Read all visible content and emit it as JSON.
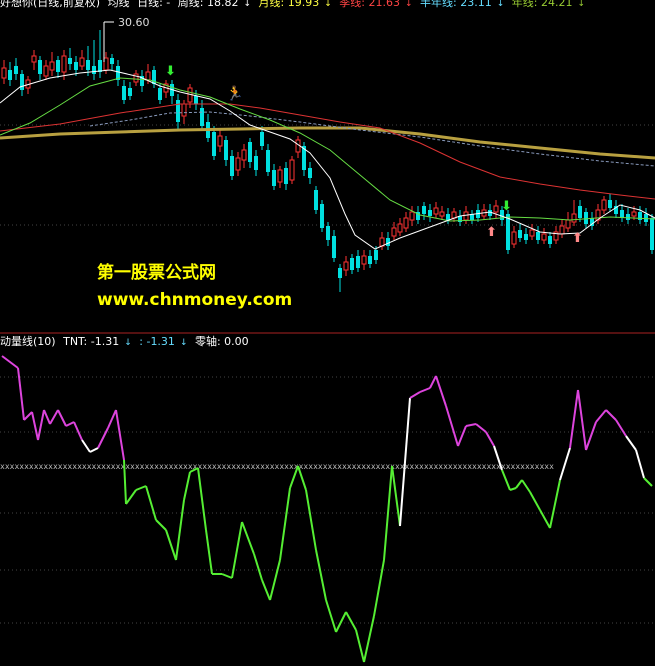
{
  "top_legend": {
    "title": "好想你(日线,前复权)",
    "indicator": "均线",
    "day_line": "日线: -",
    "week_line": "周线: 18.82",
    "month_line": "月线: 19.93",
    "season_line": "季线: 21.63",
    "halfyear_line": "半年线: 23.11",
    "year_line": "年线: 24.21"
  },
  "price_peak_label": "30.60",
  "watermark": {
    "line1": "第一股票公式网",
    "line2": "www.chnmoney.com"
  },
  "bottom_legend": {
    "title": "动量线(10)",
    "tnt": "TNT: -1.31",
    "sub": ": -1.31",
    "zero_axis": "零轴: 0.00"
  },
  "colors": {
    "up": "#ff3333",
    "down": "#00e0e0",
    "week": "#ffffff",
    "month": "#66dd44",
    "season": "#dd3333",
    "halfyear": "#8899bb",
    "year": "#b8a040",
    "momentum_pos": "#dd44dd",
    "momentum_neg": "#55ee33",
    "watermark": "#ffff00",
    "legend_yellow": "#ffff66",
    "legend_white": "#ffffff"
  },
  "icons": [
    "down-arrow-icon",
    "up-arrow-icon",
    "runner-icon"
  ]
}
